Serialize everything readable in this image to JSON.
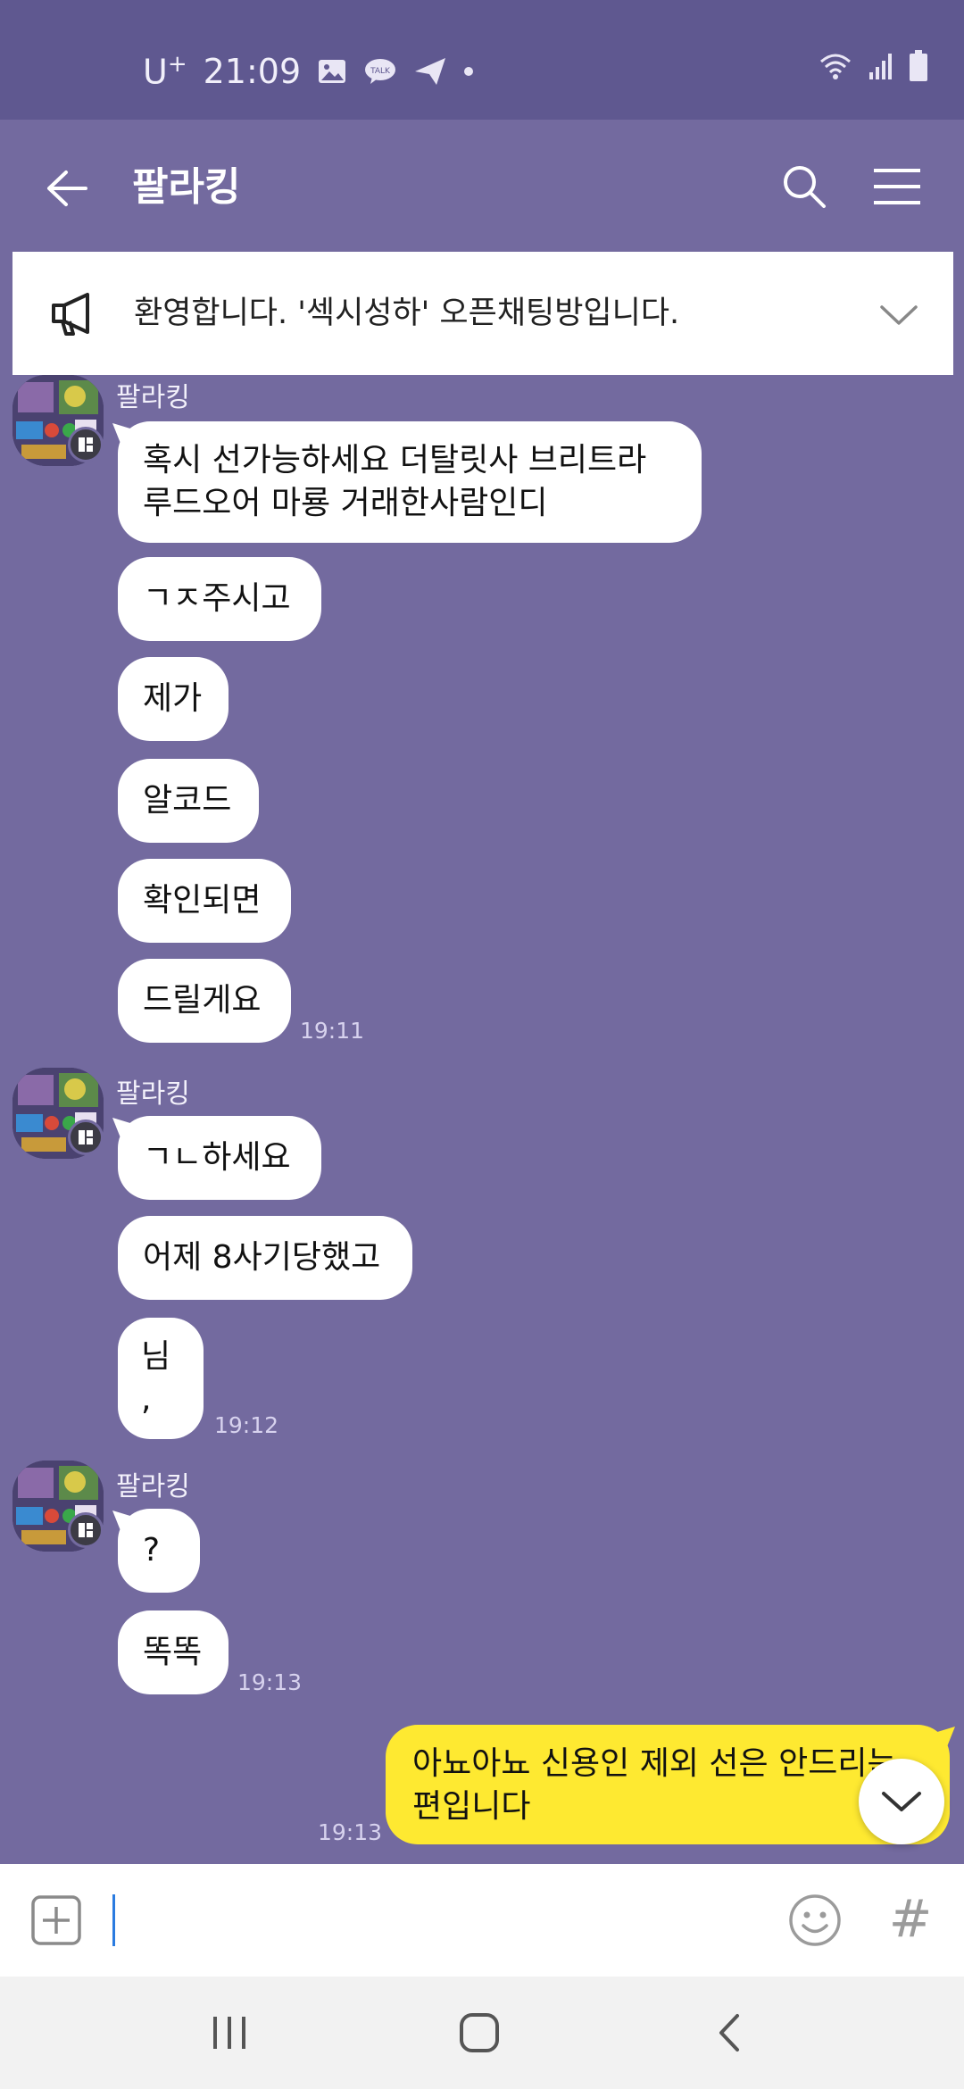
{
  "status_bar": {
    "carrier": "U",
    "carrier_sup": "+",
    "time": "21:09",
    "icons": [
      "image-icon",
      "talk-icon",
      "send-icon",
      "dot-icon",
      "wifi-icon",
      "signal-icon",
      "battery-icon"
    ]
  },
  "header": {
    "title": "팔라킹",
    "icons": [
      "back-arrow-icon",
      "search-icon",
      "menu-icon"
    ]
  },
  "notice": {
    "text": "환영합니다. '섹시성하' 오픈채팅방입니다.",
    "icons": [
      "megaphone-icon",
      "chevron-down-icon"
    ]
  },
  "messages": {
    "group1": {
      "sender": "팔라킹",
      "bubbles": [
        "혹시 선가능하세요 더탈릿사 브리트라",
        "루드오어 마룡 거래한사람인디",
        "ㄱㅈ주시고",
        "제가",
        "알코드",
        "확인되면",
        "드릴게요"
      ],
      "time": "19:11"
    },
    "group2": {
      "sender": "팔라킹",
      "bubbles": [
        "ㄱㄴ하세요",
        "어제 8사기당했고",
        "님",
        ","
      ],
      "time": "19:12"
    },
    "group3": {
      "sender": "팔라킹",
      "bubbles": [
        "?",
        "똑똑"
      ],
      "time": "19:13"
    },
    "mine": {
      "lines": [
        "아뇨아뇨 신용인 제외 선은 안드리는",
        "편입니다"
      ],
      "time": "19:13"
    }
  },
  "input_bar": {
    "placeholder": "",
    "icons": [
      "plus-icon",
      "emoji-icon",
      "hashtag-icon"
    ],
    "hash": "#"
  },
  "nav_bar": {
    "icons": [
      "recent-apps-icon",
      "home-icon",
      "back-icon"
    ]
  },
  "colors": {
    "chat_background": "#736a9f",
    "status_bar": "#5f5890",
    "my_bubble": "#fee931",
    "other_bubble": "#ffffff"
  }
}
